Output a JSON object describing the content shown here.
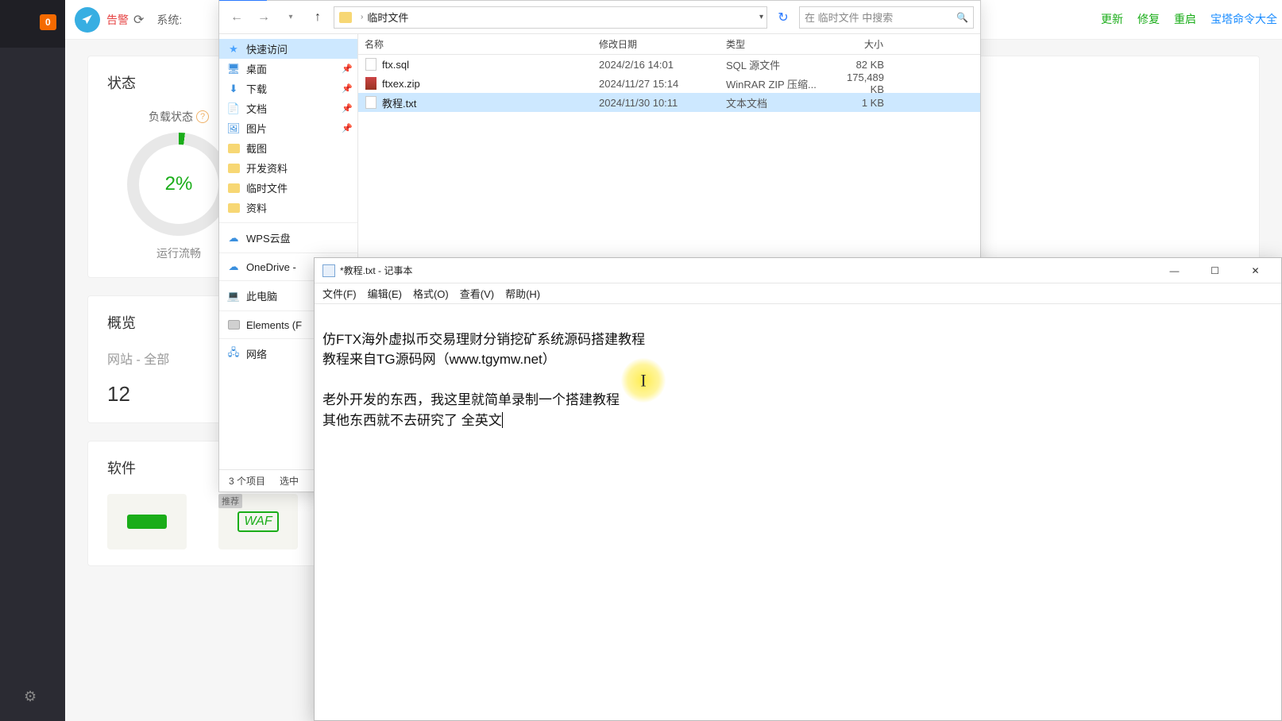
{
  "leftbar": {
    "badge": "0"
  },
  "dash": {
    "alert": "告警",
    "system": "系统:",
    "links": {
      "update": "更新",
      "repair": "修复",
      "restart": "重启",
      "bt_cmd": "宝塔命令大全"
    },
    "status": {
      "title": "状态",
      "load_label": "负载状态",
      "percent": "2%",
      "sub": "运行流畅"
    },
    "overview": {
      "title": "概览",
      "site_label": "网站 - 全部",
      "site_count": "12"
    },
    "software": {
      "title": "软件",
      "recommend": "推荐",
      "waf": "WAF"
    }
  },
  "explorer": {
    "crumb": "临时文件",
    "search_placeholder": "在 临时文件 中搜索",
    "cols": {
      "name": "名称",
      "date": "修改日期",
      "type": "类型",
      "size": "大小"
    },
    "side": {
      "quick": "快速访问",
      "desktop": "桌面",
      "downloads": "下载",
      "documents": "文档",
      "pictures": "图片",
      "screenshots": "截图",
      "dev": "开发资料",
      "temp": "临时文件",
      "data": "资料",
      "wps": "WPS云盘",
      "onedrive": "OneDrive -",
      "thispc": "此电脑",
      "elements": "Elements (F",
      "network": "网络"
    },
    "files": [
      {
        "name": "ftx.sql",
        "date": "2024/2/16 14:01",
        "type": "SQL 源文件",
        "size": "82 KB",
        "icon": "sql"
      },
      {
        "name": "ftxex.zip",
        "date": "2024/11/27 15:14",
        "type": "WinRAR ZIP 压缩...",
        "size": "175,489 KB",
        "icon": "zip"
      },
      {
        "name": "教程.txt",
        "date": "2024/11/30 10:11",
        "type": "文本文档",
        "size": "1 KB",
        "icon": "txt"
      }
    ],
    "status": {
      "items": "3 个项目",
      "selected": "选中"
    }
  },
  "notepad": {
    "title": "*教程.txt - 记事本",
    "menu": {
      "file": "文件(F)",
      "edit": "编辑(E)",
      "format": "格式(O)",
      "view": "查看(V)",
      "help": "帮助(H)"
    },
    "lines": {
      "l1": "仿FTX海外虚拟币交易理财分销挖矿系统源码搭建教程",
      "l2": "教程来自TG源码网（www.tgymw.net）",
      "l3": "",
      "l4": "老外开发的东西，我这里就简单录制一个搭建教程",
      "l5": "其他东西就不去研究了 全英文"
    }
  }
}
